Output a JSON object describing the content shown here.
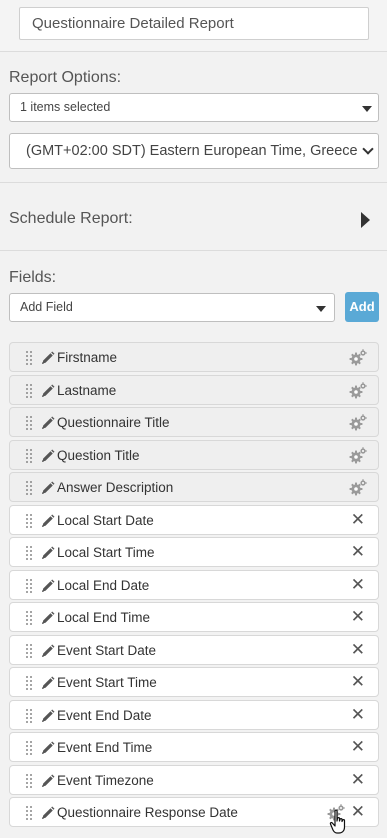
{
  "report_name": {
    "value": "Questionnaire Detailed Report"
  },
  "report_options": {
    "label": "Report Options:",
    "items_select": "1 items selected",
    "timezone_select": "(GMT+02:00 SDT) Eastern European Time, Greece"
  },
  "schedule": {
    "label": "Schedule Report:"
  },
  "fields": {
    "label": "Fields:",
    "add_field_select": "Add Field",
    "add_button": "Add",
    "items": [
      {
        "label": "Firstname",
        "action": "gear-icon"
      },
      {
        "label": "Lastname",
        "action": "gear-icon"
      },
      {
        "label": "Questionnaire Title",
        "action": "gear-icon"
      },
      {
        "label": "Question Title",
        "action": "gear-icon"
      },
      {
        "label": "Answer Description",
        "action": "gear-icon"
      },
      {
        "label": "Local Start Date",
        "action": "close-icon"
      },
      {
        "label": "Local Start Time",
        "action": "close-icon"
      },
      {
        "label": "Local End Date",
        "action": "close-icon"
      },
      {
        "label": "Local End Time",
        "action": "close-icon"
      },
      {
        "label": "Event Start Date",
        "action": "close-icon"
      },
      {
        "label": "Event Start Time",
        "action": "close-icon"
      },
      {
        "label": "Event End Date",
        "action": "close-icon"
      },
      {
        "label": "Event End Time",
        "action": "close-icon"
      },
      {
        "label": "Event Timezone",
        "action": "close-icon"
      },
      {
        "label": "Questionnaire Response Date",
        "action": "gear-icon and close-icon"
      }
    ]
  },
  "colors": {
    "accent": "#5aa9d6",
    "locked_row": "#efefef"
  }
}
